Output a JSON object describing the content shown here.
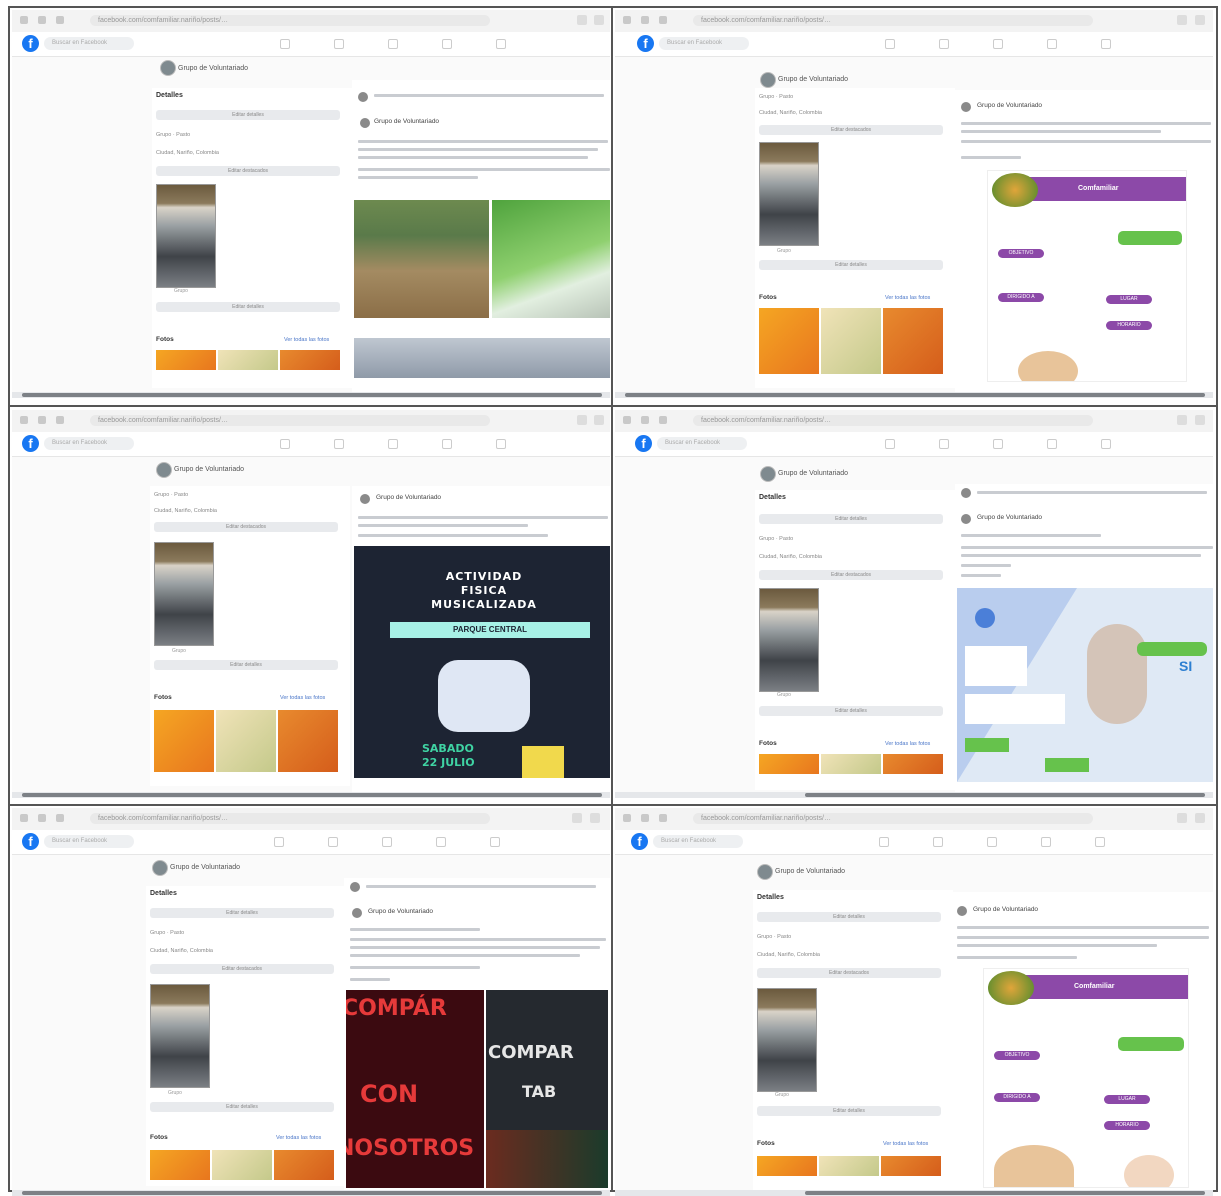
{
  "browser": {
    "url": "facebook.com/comfamiliar.nariño/posts/…",
    "search_placeholder": "Buscar en Facebook"
  },
  "profile": {
    "name": "Grupo de Voluntariado",
    "sections": {
      "details": "Detalles",
      "edit_details": "Editar detalles",
      "info_1": "Grupo · Pasto",
      "info_2": "Ciudad, Nariño, Colombia",
      "featured": "Editar destacados",
      "photos": "Fotos",
      "see_all_photos": "Ver todas las fotos",
      "photo_caption": "Grupo"
    }
  },
  "posts": {
    "p1_author": "Grupo de Voluntariado",
    "p2_author": "Grupo de Voluntariado",
    "p3_author": "Grupo de Voluntariado",
    "p4_author": "Grupo de Voluntariado",
    "p5_author": "Grupo de Voluntariado",
    "p6_author": "Grupo de Voluntariado"
  },
  "poster_activity": {
    "line1": "ACTIVIDAD",
    "line2": "FISICA",
    "line3": "MUSICALIZADA",
    "band": "PARQUE CENTRAL",
    "date1": "SABADO",
    "date2": "22 JULIO"
  },
  "poster_purple": {
    "brand": "Comfamiliar",
    "tag1": "OBJETIVO",
    "tag2": "DIRIGIDO A",
    "tag3": "LUGAR",
    "tag4": "HORARIO"
  },
  "poster_health": {
    "si": "SI"
  },
  "poster_red": {
    "w1": "COMPÁR",
    "w2": "CON",
    "w3": "NOSOTROS",
    "w4": "COMPAR",
    "w5": "TAB"
  }
}
